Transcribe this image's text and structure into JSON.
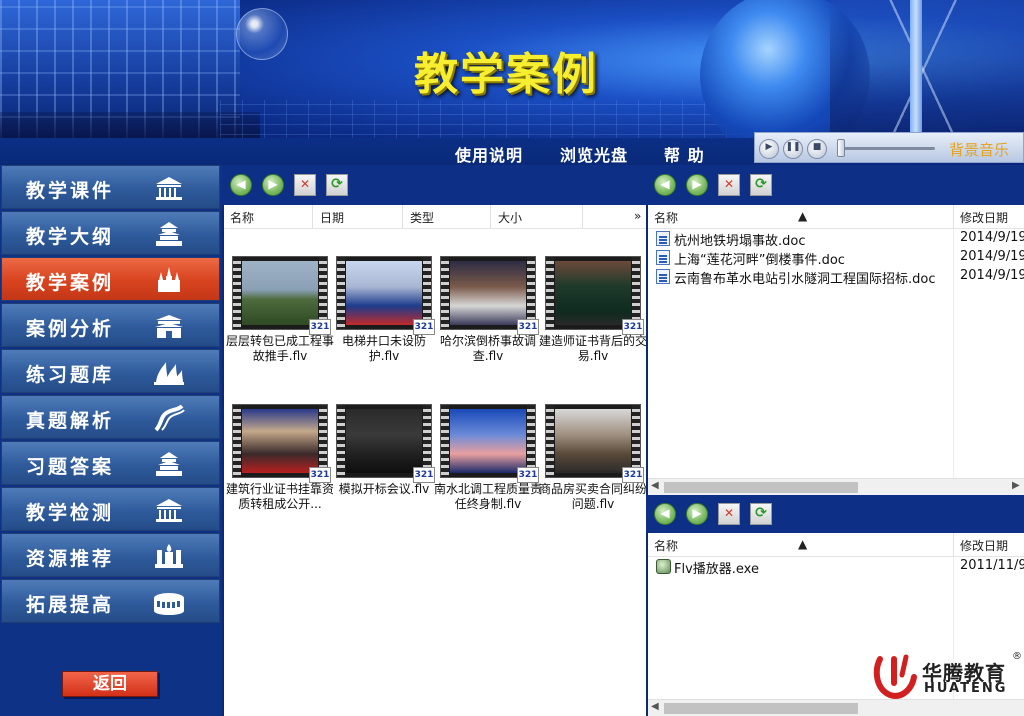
{
  "banner": {
    "title": "教学案例"
  },
  "topnav": {
    "items": [
      "使用说明",
      "浏览光盘",
      "帮 助"
    ]
  },
  "music": {
    "label": "背景音乐",
    "volume": 0
  },
  "sidebar": {
    "items": [
      {
        "label": "教学课件",
        "icon": "columns-building-icon",
        "active": false
      },
      {
        "label": "教学大纲",
        "icon": "temple-icon",
        "active": false
      },
      {
        "label": "教学案例",
        "icon": "cathedral-icon",
        "active": true
      },
      {
        "label": "案例分析",
        "icon": "gate-icon",
        "active": false
      },
      {
        "label": "练习题库",
        "icon": "opera-house-icon",
        "active": false
      },
      {
        "label": "真题解析",
        "icon": "highway-icon",
        "active": false
      },
      {
        "label": "习题答案",
        "icon": "temple-icon",
        "active": false
      },
      {
        "label": "教学检测",
        "icon": "columns-building-icon",
        "active": false
      },
      {
        "label": "资源推荐",
        "icon": "palace-icon",
        "active": false
      },
      {
        "label": "拓展提高",
        "icon": "colosseum-icon",
        "active": false
      }
    ],
    "back_label": "返回"
  },
  "left_pane": {
    "columns": [
      "名称",
      "日期",
      "类型",
      "大小"
    ],
    "more": "»",
    "videos": [
      {
        "caption": "层层转包已成工程事故推手.flv",
        "badge": "321"
      },
      {
        "caption": "电梯井口未设防护.flv",
        "badge": "321"
      },
      {
        "caption": "哈尔滨倒桥事故调查.flv",
        "badge": "321"
      },
      {
        "caption": "建造师证书背后的交易.flv",
        "badge": "321"
      },
      {
        "caption": "建筑行业证书挂靠资质转租成公开...",
        "badge": "321"
      },
      {
        "caption": "模拟开标会议.flv",
        "badge": "321"
      },
      {
        "caption": "南水北调工程质量责任终身制.flv",
        "badge": "321"
      },
      {
        "caption": "商品房买卖合同纠纷问题.flv",
        "badge": "321"
      }
    ]
  },
  "right_top_pane": {
    "columns": [
      "名称",
      "修改日期"
    ],
    "files": [
      {
        "name": "杭州地铁坍塌事故.doc",
        "date": "2014/9/19"
      },
      {
        "name": "上海“莲花河畔”倒楼事件.doc",
        "date": "2014/9/19"
      },
      {
        "name": "云南鲁布革水电站引水隧洞工程国际招标.doc",
        "date": "2014/9/19"
      }
    ]
  },
  "right_bottom_pane": {
    "columns": [
      "名称",
      "修改日期"
    ],
    "files": [
      {
        "name": "Flv播放器.exe",
        "date": "2011/11/9"
      }
    ]
  },
  "logo": {
    "text_cn": "华腾教育",
    "text_en": "HUATENG",
    "mark": "®"
  },
  "colors": {
    "active_item": "#d8431f",
    "sidebar_item": "#2f5b9c",
    "banner_title": "#f6ee2e",
    "music_label": "#e7a21a"
  }
}
